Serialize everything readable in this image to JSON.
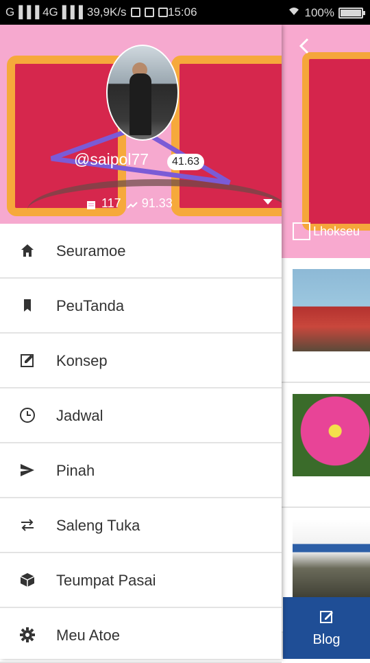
{
  "status_bar": {
    "signal_text": "G▐▐▐ 4G▐▐▐",
    "speed": "39,9K/s",
    "time": "15:06",
    "battery": "100%"
  },
  "background_screen": {
    "location_text": "Lhokseu",
    "blog_button_label": "Blog",
    "accent_color": "#1f4e96"
  },
  "profile": {
    "username": "@saipol77",
    "reputation": "41.63",
    "posts": "117",
    "power": "91.33"
  },
  "menu": {
    "items": [
      {
        "label": "Seuramoe",
        "icon": "home-icon"
      },
      {
        "label": "PeuTanda",
        "icon": "bookmark-icon"
      },
      {
        "label": "Konsep",
        "icon": "edit-icon"
      },
      {
        "label": "Jadwal",
        "icon": "clock-icon"
      },
      {
        "label": "Pinah",
        "icon": "send-icon"
      },
      {
        "label": "Saleng Tuka",
        "icon": "swap-icon"
      },
      {
        "label": "Teumpat Pasai",
        "icon": "cube-icon"
      },
      {
        "label": "Meu Atoe",
        "icon": "gear-icon"
      }
    ]
  },
  "colors": {
    "header_pink": "#f6a9cf",
    "header_red": "#d6274d",
    "header_orange": "#f6a93b"
  }
}
